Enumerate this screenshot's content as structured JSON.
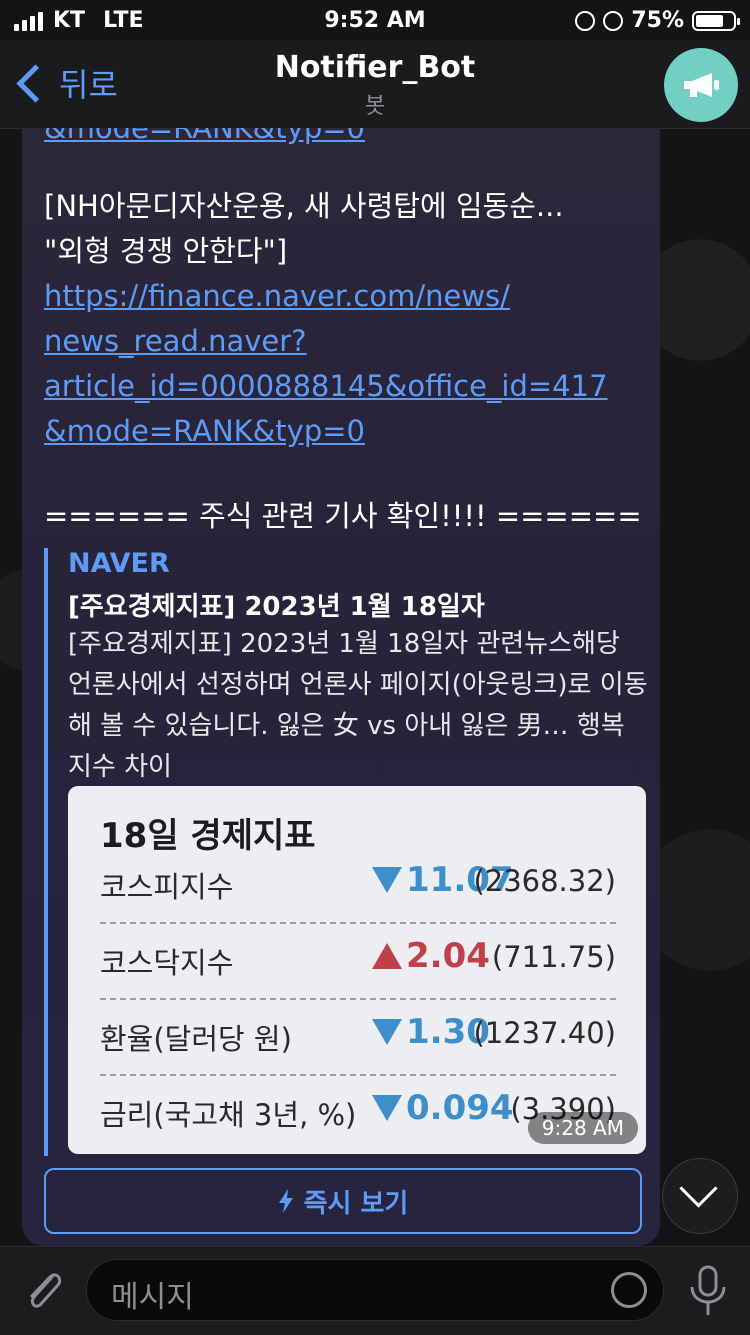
{
  "status_bar": {
    "carrier": "KT",
    "network": "LTE",
    "time": "9:52 AM",
    "battery_percent": "75%",
    "battery_level": 0.75
  },
  "header": {
    "back_label": "뒤로",
    "title": "Notifier_Bot",
    "subtitle": "봇"
  },
  "message": {
    "cut_link": "&mode=RANK&typ=0",
    "news_title_line1": "[NH아문디자산운용, 새 사령탑에 임동순...",
    "news_title_line2": "\"외형 경쟁 안한다\"]",
    "link_line1": "https://finance.naver.com/news/",
    "link_line2": "news_read.naver?",
    "link_line3": "article_id=0000888145&office_id=417",
    "link_line4": "&mode=RANK&typ=0",
    "section_header": "====== 주식 관련 기사 확인!!!! ======",
    "preview": {
      "site": "NAVER",
      "title": "[주요경제지표] 2023년 1월 18일자",
      "description": "[주요경제지표] 2023년 1월 18일자 관련뉴스해당 언론사에서 선정하며 언론사 페이지(아웃링크)로 이동해 볼 수 있습니다. 잃은 女 vs 아내 잃은 男… 행복지수 차이",
      "card": {
        "title": "18일 경제지표",
        "rows": [
          {
            "name": "코스피지수",
            "direction": "down",
            "change": "11.07",
            "level": "(2368.32)"
          },
          {
            "name": "코스닥지수",
            "direction": "up",
            "change": "2.04",
            "level": "(711.75)"
          },
          {
            "name": "환율(달러당 원)",
            "direction": "down",
            "change": "1.30",
            "level": "(1237.40)"
          },
          {
            "name": "금리(국고채 3년, %)",
            "direction": "down",
            "change": "0.094",
            "level": "(3.390)"
          }
        ]
      },
      "timestamp": "9:28 AM"
    },
    "instant_view_label": "즉시 보기"
  },
  "composer": {
    "placeholder": "메시지"
  },
  "colors": {
    "accent": "#5e9bf5",
    "bubble": "#2c2639",
    "down": "#3d8ec9",
    "up": "#c0404a"
  }
}
